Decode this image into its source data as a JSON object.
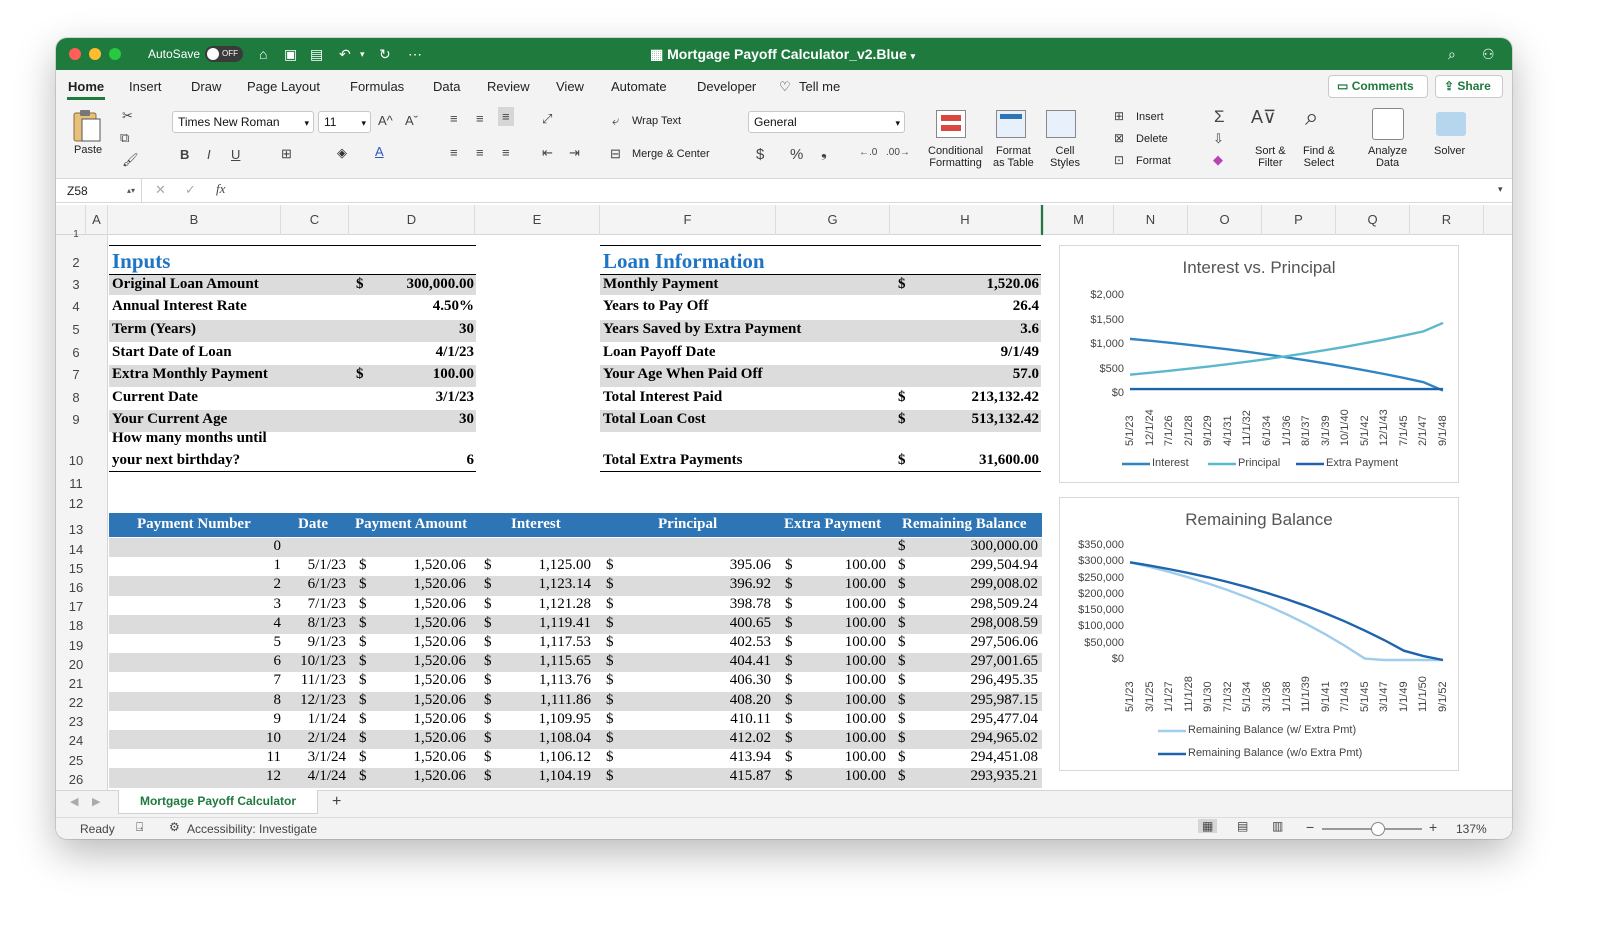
{
  "window": {
    "title": "Mortgage Payoff Calculator_v2.Blue",
    "autosave_label": "AutoSave",
    "autosave_state": "OFF"
  },
  "tabs": [
    "Home",
    "Insert",
    "Draw",
    "Page Layout",
    "Formulas",
    "Data",
    "Review",
    "View",
    "Automate",
    "Developer"
  ],
  "tell_me": "Tell me",
  "comments_label": "Comments",
  "share_label": "Share",
  "ribbon": {
    "paste": "Paste",
    "font_name": "Times New Roman",
    "font_size": "11",
    "wrap_text": "Wrap Text",
    "merge_center": "Merge & Center",
    "number_format": "General",
    "conditional_formatting": [
      "Conditional",
      "Formatting"
    ],
    "format_as_table": [
      "Format",
      "as Table"
    ],
    "cell_styles": [
      "Cell",
      "Styles"
    ],
    "insert": "Insert",
    "delete": "Delete",
    "format": "Format",
    "sort_filter": [
      "Sort &",
      "Filter"
    ],
    "find_select": [
      "Find &",
      "Select"
    ],
    "analyze_data": [
      "Analyze",
      "Data"
    ],
    "solver": "Solver"
  },
  "formula_bar": {
    "name_box": "Z58",
    "formula": ""
  },
  "columns": [
    "A",
    "B",
    "C",
    "D",
    "E",
    "F",
    "G",
    "H",
    "M",
    "N",
    "O",
    "P",
    "Q",
    "R"
  ],
  "rows": [
    "1",
    "2",
    "3",
    "4",
    "5",
    "6",
    "7",
    "8",
    "9",
    "10",
    "11",
    "12",
    "13",
    "14",
    "15",
    "16",
    "17",
    "18",
    "19",
    "20",
    "21",
    "22",
    "23",
    "24",
    "25",
    "26"
  ],
  "inputs": {
    "title": "Inputs",
    "items": [
      {
        "label": "Original Loan Amount",
        "sym": "$",
        "value": "300,000.00"
      },
      {
        "label": "Annual Interest Rate",
        "sym": "",
        "value": "4.50%"
      },
      {
        "label": "Term (Years)",
        "sym": "",
        "value": "30"
      },
      {
        "label": "Start Date of Loan",
        "sym": "",
        "value": "4/1/23"
      },
      {
        "label": "Extra Monthly Payment",
        "sym": "$",
        "value": "100.00"
      },
      {
        "label": "Current Date",
        "sym": "",
        "value": "3/1/23"
      },
      {
        "label": "Your Current Age",
        "sym": "",
        "value": "30"
      }
    ],
    "months_label_1": "How many months until",
    "months_label_2": "your next birthday?",
    "months_value": "6"
  },
  "loan_info": {
    "title": "Loan Information",
    "items": [
      {
        "label": "Monthly Payment",
        "sym": "$",
        "value": "1,520.06"
      },
      {
        "label": "Years to Pay Off",
        "sym": "",
        "value": "26.4"
      },
      {
        "label": "Years Saved by Extra Payment",
        "sym": "",
        "value": "3.6"
      },
      {
        "label": "Loan Payoff Date",
        "sym": "",
        "value": "9/1/49"
      },
      {
        "label": "Your Age When Paid Off",
        "sym": "",
        "value": "57.0"
      },
      {
        "label": "Total Interest Paid",
        "sym": "$",
        "value": "213,132.42"
      },
      {
        "label": "Total Loan Cost",
        "sym": "$",
        "value": "513,132.42"
      }
    ],
    "extra_label": "Total Extra Payments",
    "extra_sym": "$",
    "extra_value": "31,600.00"
  },
  "table": {
    "headers": [
      "Payment Number",
      "Date",
      "Payment Amount",
      "Interest",
      "Principal",
      "Extra Payment",
      "Remaining Balance"
    ],
    "currency": "$",
    "rows": [
      [
        "0",
        "",
        "",
        "",
        "",
        "",
        "300,000.00"
      ],
      [
        "1",
        "5/1/23",
        "1,520.06",
        "1,125.00",
        "395.06",
        "100.00",
        "299,504.94"
      ],
      [
        "2",
        "6/1/23",
        "1,520.06",
        "1,123.14",
        "396.92",
        "100.00",
        "299,008.02"
      ],
      [
        "3",
        "7/1/23",
        "1,520.06",
        "1,121.28",
        "398.78",
        "100.00",
        "298,509.24"
      ],
      [
        "4",
        "8/1/23",
        "1,520.06",
        "1,119.41",
        "400.65",
        "100.00",
        "298,008.59"
      ],
      [
        "5",
        "9/1/23",
        "1,520.06",
        "1,117.53",
        "402.53",
        "100.00",
        "297,506.06"
      ],
      [
        "6",
        "10/1/23",
        "1,520.06",
        "1,115.65",
        "404.41",
        "100.00",
        "297,001.65"
      ],
      [
        "7",
        "11/1/23",
        "1,520.06",
        "1,113.76",
        "406.30",
        "100.00",
        "296,495.35"
      ],
      [
        "8",
        "12/1/23",
        "1,520.06",
        "1,111.86",
        "408.20",
        "100.00",
        "295,987.15"
      ],
      [
        "9",
        "1/1/24",
        "1,520.06",
        "1,109.95",
        "410.11",
        "100.00",
        "295,477.04"
      ],
      [
        "10",
        "2/1/24",
        "1,520.06",
        "1,108.04",
        "412.02",
        "100.00",
        "294,965.02"
      ],
      [
        "11",
        "3/1/24",
        "1,520.06",
        "1,106.12",
        "413.94",
        "100.00",
        "294,451.08"
      ],
      [
        "12",
        "4/1/24",
        "1,520.06",
        "1,104.19",
        "415.87",
        "100.00",
        "293,935.21"
      ]
    ]
  },
  "chart_data": [
    {
      "type": "line",
      "title": "Interest vs. Principal",
      "ylim": [
        0,
        2000
      ],
      "y_ticks": [
        "$2,000",
        "$1,500",
        "$1,000",
        "$500",
        "$0"
      ],
      "x": [
        "5/1/23",
        "12/1/24",
        "7/1/26",
        "2/1/28",
        "9/1/29",
        "4/1/31",
        "11/1/32",
        "6/1/34",
        "1/1/36",
        "8/1/37",
        "3/1/39",
        "10/1/40",
        "5/1/42",
        "12/1/43",
        "7/1/45",
        "2/1/47",
        "9/1/48"
      ],
      "legend": "bottom",
      "series": [
        {
          "name": "Interest",
          "color": "#2f85c3",
          "values": [
            1125,
            1087,
            1047,
            1004,
            959,
            911,
            860,
            806,
            749,
            688,
            624,
            556,
            484,
            408,
            327,
            242,
            70
          ]
        },
        {
          "name": "Principal",
          "color": "#5bb8cc",
          "values": [
            395,
            433,
            473,
            516,
            561,
            609,
            660,
            714,
            771,
            832,
            896,
            964,
            1036,
            1112,
            1193,
            1278,
            1450
          ]
        },
        {
          "name": "Extra Payment",
          "color": "#1e64ad",
          "values": [
            100,
            100,
            100,
            100,
            100,
            100,
            100,
            100,
            100,
            100,
            100,
            100,
            100,
            100,
            100,
            100,
            100
          ]
        }
      ]
    },
    {
      "type": "line",
      "title": "Remaining Balance",
      "ylim": [
        0,
        350000
      ],
      "y_ticks": [
        "$350,000",
        "$300,000",
        "$250,000",
        "$200,000",
        "$150,000",
        "$100,000",
        "$50,000",
        "$0"
      ],
      "x": [
        "5/1/23",
        "3/1/25",
        "1/1/27",
        "11/1/28",
        "9/1/30",
        "7/1/32",
        "5/1/34",
        "3/1/36",
        "1/1/38",
        "11/1/39",
        "9/1/41",
        "7/1/43",
        "5/1/45",
        "3/1/47",
        "1/1/49",
        "11/1/50",
        "9/1/52"
      ],
      "legend": "bottom",
      "series": [
        {
          "name": "Remaining Balance (w/ Extra Pmt)",
          "color": "#9fcdea",
          "values": [
            300000,
            286000,
            270500,
            253500,
            235000,
            214500,
            192000,
            167500,
            140500,
            111000,
            78500,
            43000,
            4500,
            0,
            0,
            0,
            0
          ]
        },
        {
          "name": "Remaining Balance (w/o Extra Pmt)",
          "color": "#1e64ad",
          "values": [
            300000,
            290000,
            279000,
            267000,
            254000,
            239500,
            223500,
            206000,
            187000,
            166000,
            143000,
            118000,
            90500,
            61000,
            28500,
            12000,
            0
          ]
        }
      ]
    }
  ],
  "sheet_tab": "Mortgage Payoff Calculator",
  "status": {
    "ready": "Ready",
    "accessibility": "Accessibility: Investigate",
    "zoom": "137%"
  }
}
